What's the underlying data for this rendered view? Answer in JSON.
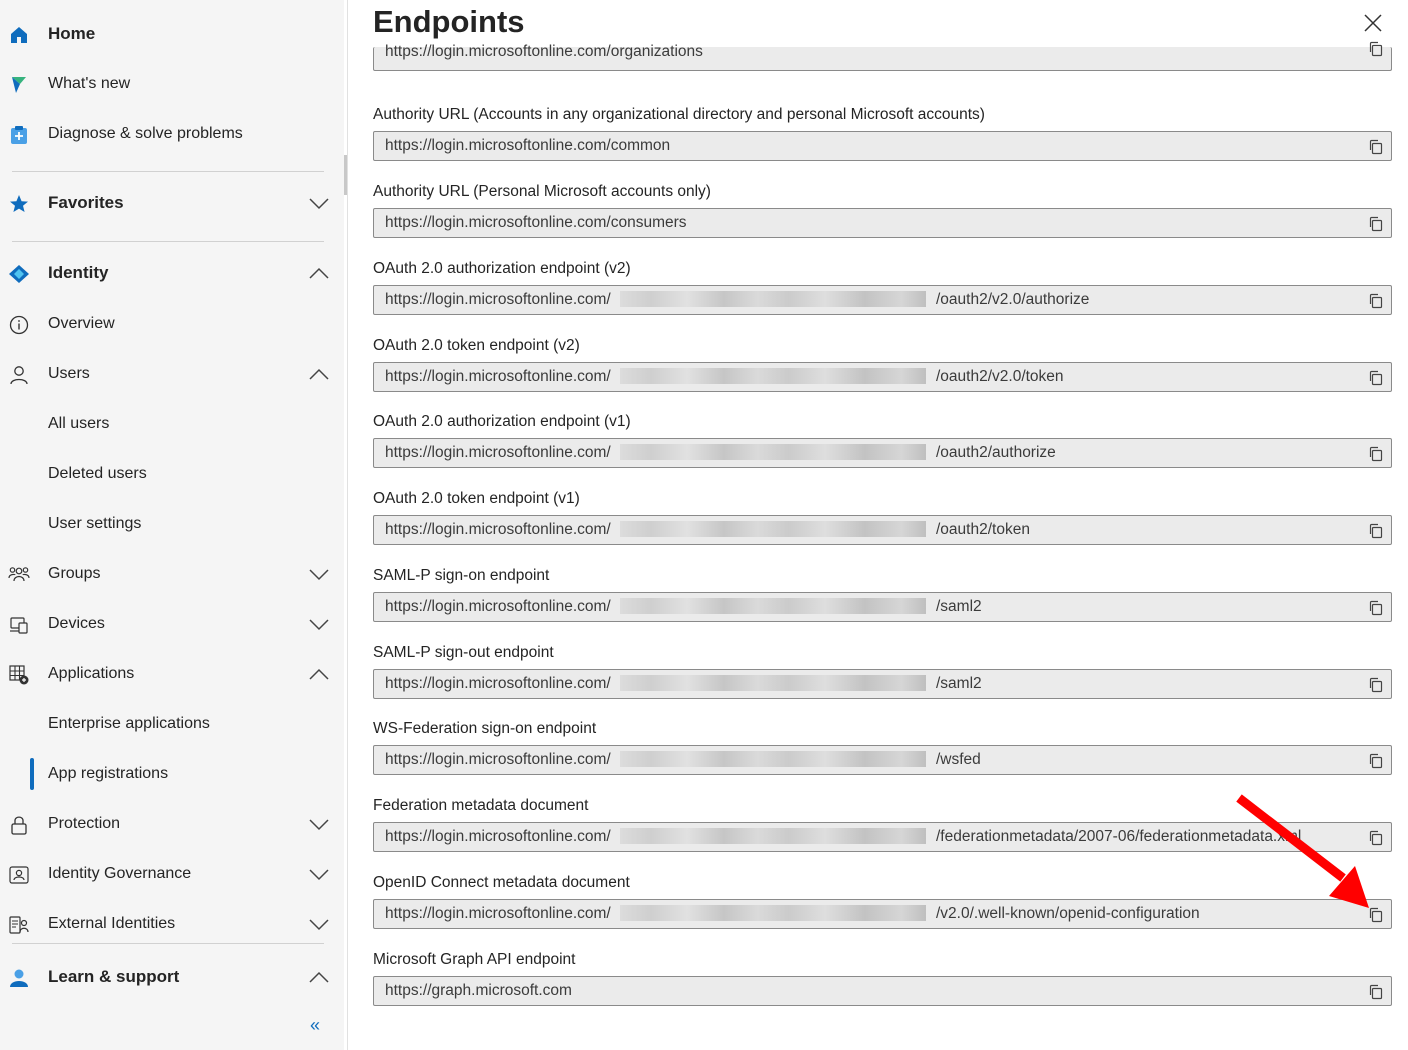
{
  "sidebar": {
    "home": "Home",
    "whats_new": "What's new",
    "diagnose": "Diagnose & solve problems",
    "favorites": "Favorites",
    "identity": "Identity",
    "overview": "Overview",
    "users": "Users",
    "all_users": "All users",
    "deleted_users": "Deleted users",
    "user_settings": "User settings",
    "groups": "Groups",
    "devices": "Devices",
    "applications": "Applications",
    "enterprise_apps": "Enterprise applications",
    "app_registrations": "App registrations",
    "protection": "Protection",
    "identity_governance": "Identity Governance",
    "external_identities": "External Identities",
    "learn_support": "Learn & support",
    "collapse_glyph": "«",
    "icons": [
      "home-icon",
      "whats-new-icon",
      "diagnose-icon",
      "favorites-star-icon",
      "identity-icon",
      "overview-info-icon",
      "users-person-icon",
      "groups-icon",
      "devices-icon",
      "applications-icon",
      "protection-lock-icon",
      "identity-governance-icon",
      "external-identities-icon",
      "learn-support-icon"
    ]
  },
  "panel": {
    "title": "Endpoints",
    "endpoints": [
      {
        "label": "",
        "value": "https://login.microsoftonline.com/organizations",
        "suffix": ""
      },
      {
        "label": "Authority URL (Accounts in any organizational directory and personal Microsoft accounts)",
        "value": "https://login.microsoftonline.com/common",
        "suffix": ""
      },
      {
        "label": "Authority URL (Personal Microsoft accounts only)",
        "value": "https://login.microsoftonline.com/consumers",
        "suffix": ""
      },
      {
        "label": "OAuth 2.0 authorization endpoint (v2)",
        "value": "https://login.microsoftonline.com/",
        "suffix": "/oauth2/v2.0/authorize"
      },
      {
        "label": "OAuth 2.0 token endpoint (v2)",
        "value": "https://login.microsoftonline.com/",
        "suffix": "/oauth2/v2.0/token"
      },
      {
        "label": "OAuth 2.0 authorization endpoint (v1)",
        "value": "https://login.microsoftonline.com/",
        "suffix": "/oauth2/authorize"
      },
      {
        "label": "OAuth 2.0 token endpoint (v1)",
        "value": "https://login.microsoftonline.com/",
        "suffix": "/oauth2/token"
      },
      {
        "label": "SAML-P sign-on endpoint",
        "value": "https://login.microsoftonline.com/",
        "suffix": "/saml2"
      },
      {
        "label": "SAML-P sign-out endpoint",
        "value": "https://login.microsoftonline.com/",
        "suffix": "/saml2"
      },
      {
        "label": "WS-Federation sign-on endpoint",
        "value": "https://login.microsoftonline.com/",
        "suffix": "/wsfed"
      },
      {
        "label": "Federation metadata document",
        "value": "https://login.microsoftonline.com/",
        "suffix": "/federationmetadata/2007-06/federationmetadata.xml"
      },
      {
        "label": "OpenID Connect metadata document",
        "value": "https://login.microsoftonline.com/",
        "suffix": "/v2.0/.well-known/openid-configuration"
      },
      {
        "label": "Microsoft Graph API endpoint",
        "value": "https://graph.microsoft.com",
        "suffix": ""
      }
    ]
  },
  "colors": {
    "accent": "#0f6cbd",
    "annotation_arrow": "#ff0000"
  }
}
